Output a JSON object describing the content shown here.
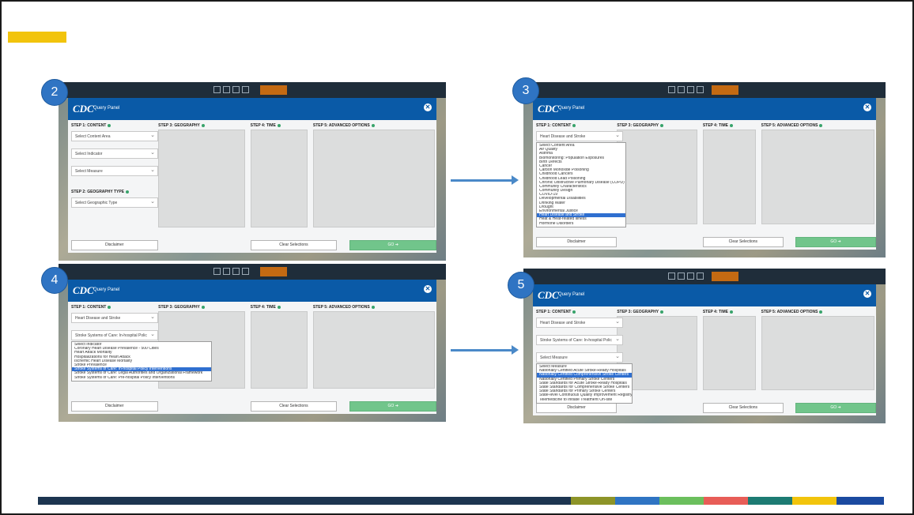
{
  "colors": {
    "accent": "#f2c40c",
    "badge": "#2f74c3",
    "cdc_blue": "#0a5aa7",
    "go_green": "#71c58b",
    "highlight": "#2f6fd0"
  },
  "bottom_stripe": [
    "#1d3550",
    "#8d9428",
    "#2f74c3",
    "#6bbf5d",
    "#e85d57",
    "#1d7b73",
    "#f2c40c",
    "#1b4aa0"
  ],
  "panel": {
    "logo": "CDC",
    "title": "Query Panel",
    "close_icon": "close-icon",
    "step1": "STEP 1: CONTENT",
    "step2": "STEP 2: GEOGRAPHY TYPE",
    "step3": "STEP 3: GEOGRAPHY",
    "step4": "STEP 4: TIME",
    "step5": "STEP 5: ADVANCED OPTIONS",
    "disclaimer": "Disclaimer",
    "clear": "Clear Selections",
    "go": "GO ➔"
  },
  "shots": [
    {
      "badge": "2",
      "content_area": "Select Content Area",
      "indicator": "Select Indicator",
      "measure": "Select Measure",
      "geo_type": "Select Geographic Type"
    },
    {
      "badge": "3",
      "content_area": "Heart Disease and Stroke",
      "options": [
        "Select Content Area",
        "Air Quality",
        "Asthma",
        "Biomonitoring: Population Exposures",
        "Birth Defects",
        "Cancer",
        "Carbon Monoxide Poisoning",
        "Childhood Cancers",
        "Childhood Lead Poisoning",
        "Chronic Obstructive Pulmonary Disease (COPD)",
        "Community Characteristics",
        "Community Design",
        "COVID-19",
        "Developmental Disabilities",
        "Drinking Water",
        "Drought",
        "Environmental Justice",
        "Heart Disease and Stroke",
        "Heat & Heat-related Illness",
        "Hormone Disorders"
      ],
      "selected": "Heart Disease and Stroke"
    },
    {
      "badge": "4",
      "content_area": "Heart Disease and Stroke",
      "indicator": "Stroke Systems of Care: In-hospital Polic",
      "options": [
        "Select Indicator",
        "Coronary Heart Disease Prevalence - 500 Cities",
        "Heart Attack Mortality",
        "Hospitalizations for Heart Attack",
        "Ischemic Heart Disease Mortality",
        "Stroke Prevalence",
        "Stroke Systems of Care: In-hospital Policy Interventions",
        "Stroke Systems of Care: Legal Authorities and Organizational Framework",
        "Stroke Systems of Care: Pre-hospital Policy Interventions"
      ],
      "selected": "Stroke Systems of Care: In-hospital Policy Interventions"
    },
    {
      "badge": "5",
      "content_area": "Heart Disease and Stroke",
      "indicator": "Stroke Systems of Care: In-hospital Polic",
      "measure": "Select Measure",
      "options": [
        "Select Measure",
        "Nationally Certified Acute Stroke-Ready Hospitals",
        "Nationally Certified Comprehensive Stroke Centers",
        "Nationally Certified Primary Stroke Centers",
        "State Standards for Acute Stroke-Ready Hospitals",
        "State Standards for Comprehensive Stroke Centers",
        "State Standards for Primary Stroke Centers",
        "State-level Continuous Quality Improvement Registry",
        "Telemedicine to Initiate Treatment On-site"
      ],
      "selected": "Nationally Certified Comprehensive Stroke Centers"
    }
  ]
}
